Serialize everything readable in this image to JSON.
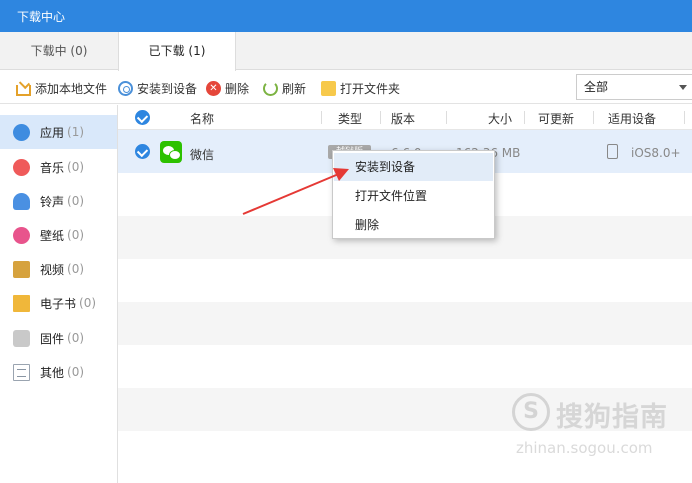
{
  "window": {
    "title": "下载中心"
  },
  "tabs": [
    {
      "label": "下载中 (0)"
    },
    {
      "label": "已下载 (1)"
    }
  ],
  "toolbar": {
    "add_local": "添加本地文件",
    "install": "安装到设备",
    "delete": "删除",
    "refresh": "刷新",
    "open_folder": "打开文件夹",
    "filter_selected": "全部"
  },
  "sidebar": {
    "items": [
      {
        "label": "应用",
        "count": "(1)",
        "icon": "app-store-icon"
      },
      {
        "label": "音乐",
        "count": "(0)",
        "icon": "music-icon"
      },
      {
        "label": "铃声",
        "count": "(0)",
        "icon": "bell-icon"
      },
      {
        "label": "壁纸",
        "count": "(0)",
        "icon": "wallpaper-icon"
      },
      {
        "label": "视频",
        "count": "(0)",
        "icon": "video-icon"
      },
      {
        "label": "电子书",
        "count": "(0)",
        "icon": "book-icon"
      },
      {
        "label": "固件",
        "count": "(0)",
        "icon": "firmware-icon"
      },
      {
        "label": "其他",
        "count": "(0)",
        "icon": "other-icon"
      }
    ]
  },
  "table": {
    "headers": {
      "name": "名称",
      "type": "类型",
      "version": "版本",
      "size": "大小",
      "updatable": "可更新",
      "device": "适用设备"
    },
    "rows": [
      {
        "name": "微信",
        "type": "越狱版",
        "version": "6.6.0",
        "size": "162.36 MB",
        "updatable": "",
        "device": "iOS8.0+"
      }
    ]
  },
  "context_menu": {
    "items": [
      {
        "label": "安装到设备"
      },
      {
        "label": "打开文件位置"
      },
      {
        "label": "删除"
      }
    ]
  },
  "watermark": {
    "logo": "S",
    "text": "搜狗指南",
    "url": "zhinan.sogou.com"
  },
  "colors": {
    "titlebar": "#2e86e0",
    "selected_row": "#e4eefb",
    "sidebar_active": "#d9e8fa",
    "arrow": "#e53935"
  }
}
